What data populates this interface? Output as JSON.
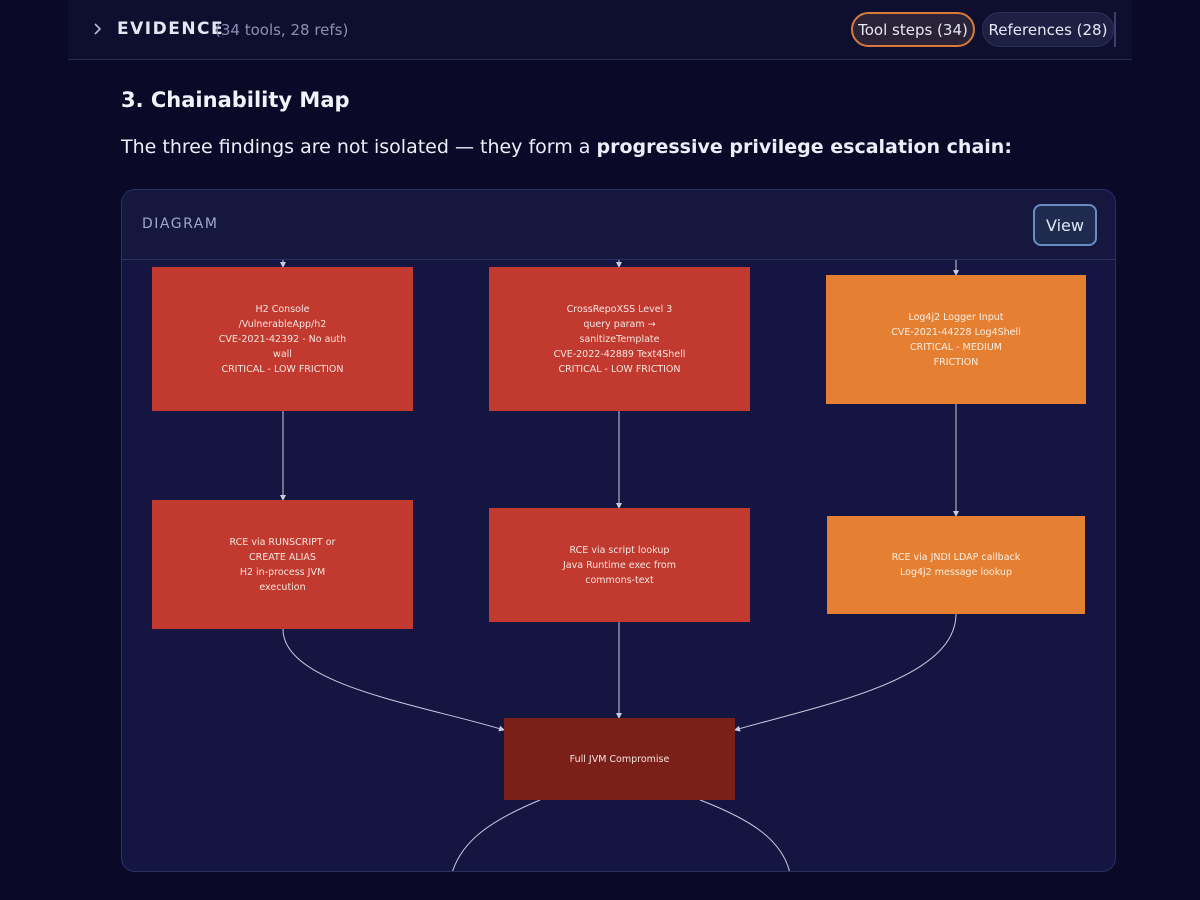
{
  "evidence": {
    "label": "EVIDENCE",
    "count": "(34 tools, 28 refs)",
    "tool_steps": "Tool steps (34)",
    "references": "References (28)",
    "colors": {
      "tool_steps_border": "#d97a3c"
    }
  },
  "section": {
    "heading": "3. Chainability Map",
    "intro_plain": "The three findings are not isolated — they form a ",
    "intro_bold": "progressive privilege escalation chain:"
  },
  "diagram": {
    "label": "DIAGRAM",
    "view_button": "View",
    "nodes": {
      "h2": "H2 Console\n/VulnerableApp/h2\nCVE-2021-42392 - No auth\nwall\nCRITICAL - LOW FRICTION",
      "xss": "CrossRepoXSS Level 3\nquery param →\nsanitizeTemplate\nCVE-2022-42889 Text4Shell\nCRITICAL - LOW FRICTION",
      "log4j": "Log4j2 Logger Input\nCVE-2021-44228 Log4Shell\nCRITICAL - MEDIUM\nFRICTION",
      "rce_h2": "RCE via RUNSCRIPT or\nCREATE ALIAS\nH2 in-process JVM\nexecution",
      "rce_script": "RCE via script lookup\nJava Runtime exec from\ncommons-text",
      "rce_jndi": "RCE via JNDI LDAP callback\nLog4j2 message lookup",
      "full": "Full JVM Compromise"
    },
    "colors": {
      "critical_low": "#c23a2f",
      "critical_medium": "#e58033",
      "compromise": "#7a2018",
      "edge": "#c9cbe0"
    }
  }
}
